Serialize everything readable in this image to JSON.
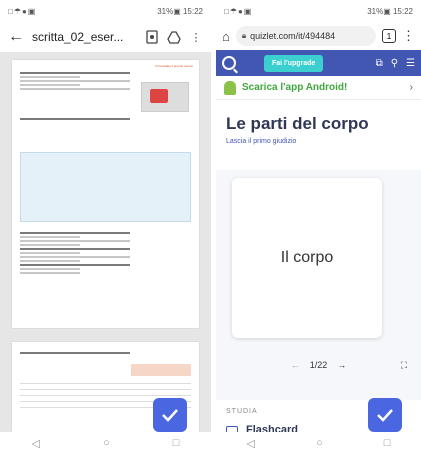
{
  "left": {
    "status": {
      "icons": "□☂●▣",
      "right": "31%▣ 15:22"
    },
    "toolbar": {
      "title": "scritta_02_eser..."
    },
    "page1": {
      "header": "Consolidate il proprio esame"
    },
    "page2": {
      "header": ""
    }
  },
  "right": {
    "status": {
      "icons": "□☂●▣",
      "right": "31%▣ 15:22"
    },
    "browser": {
      "url": "quizlet.com/it/494484",
      "tabs": "1"
    },
    "quizlet": {
      "upgrade_label": "Fai l'upgrade",
      "banner": "Scarica l'app Android!",
      "set_title": "Le parti del corpo",
      "rate_label": "Lascia il primo giudizio",
      "card_term": "Il corpo",
      "counter": "1/22",
      "section": "STUDIA",
      "flashcard_label": "Flashcard"
    }
  }
}
